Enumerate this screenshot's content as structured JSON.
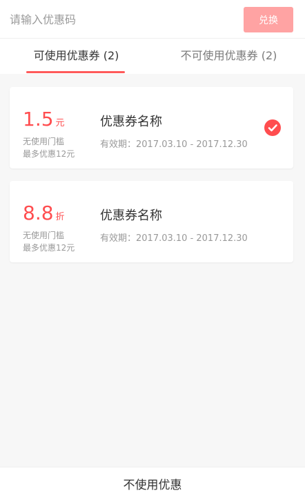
{
  "redeem": {
    "placeholder": "请输入优惠码",
    "button_label": "兑换"
  },
  "tabs": [
    {
      "label": "可使用优惠券 (2)",
      "active": true
    },
    {
      "label": "不可使用优惠券 (2)",
      "active": false
    }
  ],
  "coupons": [
    {
      "value": "1.5",
      "unit": "元",
      "threshold": "无使用门槛",
      "max_discount": "最多优惠12元",
      "name": "优惠券名称",
      "validity": "有效期：2017.03.10 - 2017.12.30",
      "selected": true
    },
    {
      "value": "8.8",
      "unit": "折",
      "threshold": "无使用门槛",
      "max_discount": "最多优惠12元",
      "name": "优惠券名称",
      "validity": "有效期：2017.03.10 - 2017.12.30",
      "selected": false
    }
  ],
  "footer": {
    "label": "不使用优惠"
  },
  "colors": {
    "accent": "#ff4d4f",
    "button_disabled": "#ffa3a3",
    "background": "#f7f7f7"
  },
  "icons": {
    "selected": "check-circle-icon"
  }
}
